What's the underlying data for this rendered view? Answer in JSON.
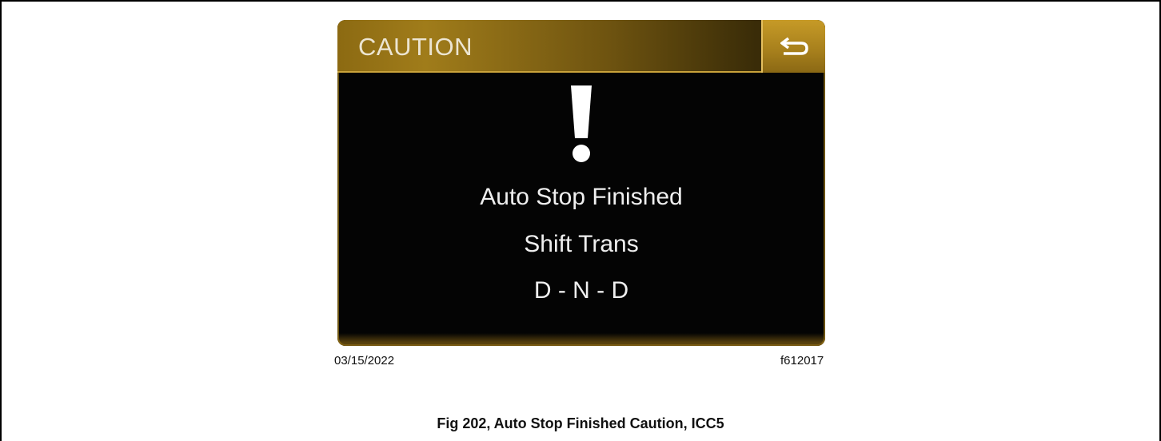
{
  "screen": {
    "header": {
      "title": "CAUTION",
      "back_icon": "back-arrow-icon"
    },
    "alert_icon": "exclamation-icon",
    "messages": [
      "Auto Stop Finished",
      "Shift Trans",
      "D - N - D"
    ],
    "colors": {
      "header_gold": "#a07c1a",
      "button_gold": "#c69a27",
      "background": "#040404",
      "text": "#efefef"
    }
  },
  "figure": {
    "date": "03/15/2022",
    "id": "f612017",
    "caption": "Fig 202, Auto Stop Finished Caution, ICC5"
  }
}
